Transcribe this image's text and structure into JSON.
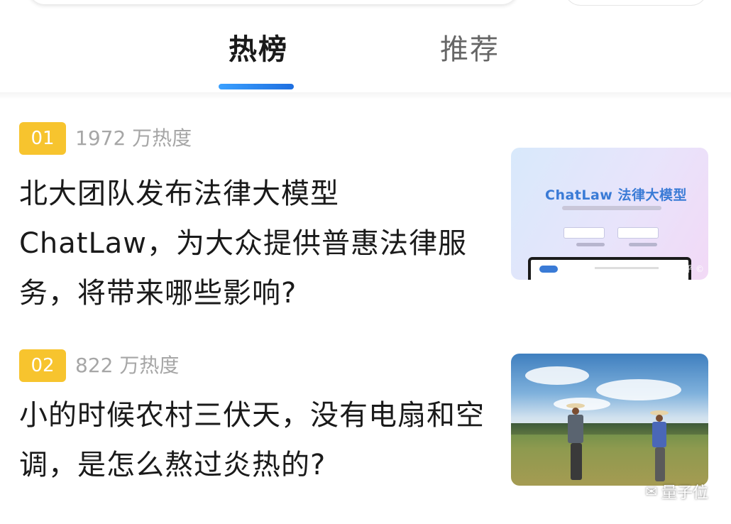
{
  "tabs": [
    {
      "label": "热榜",
      "active": true
    },
    {
      "label": "推荐",
      "active": false
    }
  ],
  "items": [
    {
      "rank": "01",
      "heat": "1972 万热度",
      "title": "北大团队发布法律大模型ChatLaw，为大众提供普惠法律服务，将带来哪些影响?",
      "thumb": {
        "title": "ChatLaw 法律大模型",
        "watermark": "知乎 ©"
      }
    },
    {
      "rank": "02",
      "heat": "822 万热度",
      "title": "小的时候农村三伏天，没有电扇和空调，是怎么熬过炎热的?"
    }
  ],
  "brand": {
    "name": "量子位",
    "icon": "wechat-icon"
  },
  "colors": {
    "rank_badge": "#f7c42e",
    "tab_indicator": "#1e6fe0",
    "thumb_title": "#3a7bd6"
  }
}
